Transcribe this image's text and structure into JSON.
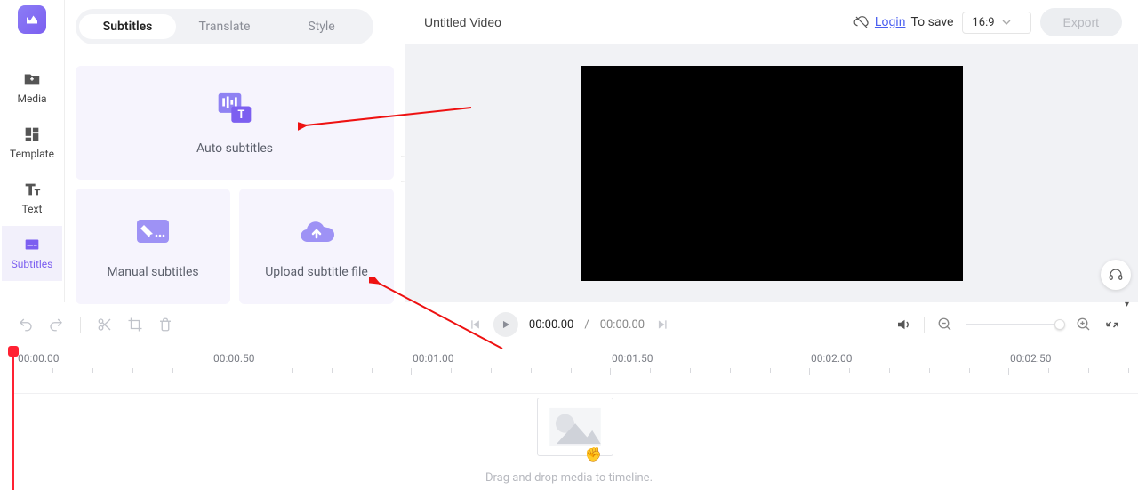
{
  "header": {
    "title_value": "Untitled Video",
    "login_text": "Login",
    "to_save_text": "To save",
    "aspect_ratio": "16:9",
    "export_label": "Export"
  },
  "sidebar": {
    "items": [
      {
        "label": "Media"
      },
      {
        "label": "Template"
      },
      {
        "label": "Text"
      },
      {
        "label": "Subtitles"
      }
    ],
    "active_index": 3
  },
  "tabs": {
    "items": [
      "Subtitles",
      "Translate",
      "Style"
    ],
    "active_index": 0
  },
  "cards": {
    "auto": "Auto subtitles",
    "manual": "Manual subtitles",
    "upload": "Upload subtitle file"
  },
  "playback": {
    "current_time": "00:00.00",
    "separator": "/",
    "total_time": "00:00.00"
  },
  "ruler": {
    "labels": [
      "00:00.00",
      "00:00.50",
      "00:01.00",
      "00:01.50",
      "00:02.00",
      "00:02.50"
    ]
  },
  "timeline": {
    "drop_hint": "Drag and drop media to timeline."
  },
  "colors": {
    "accent": "#7c5ff0",
    "panel_bg": "#f6f4fd"
  }
}
